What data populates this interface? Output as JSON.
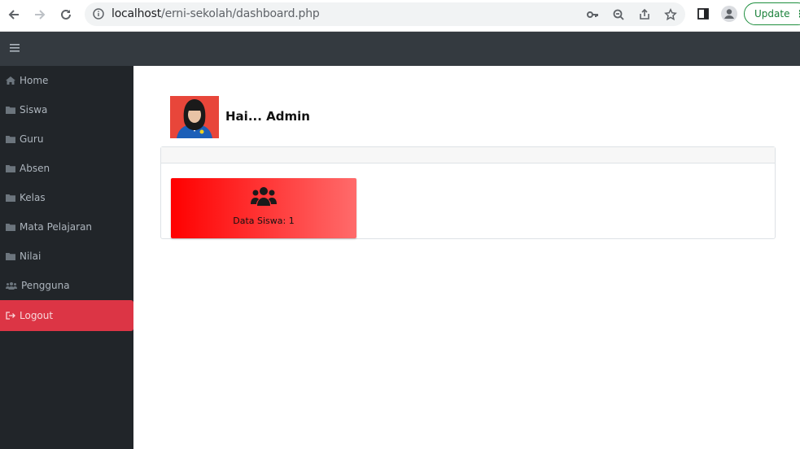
{
  "browser": {
    "url_host": "localhost",
    "url_path": "/erni-sekolah/dashboard.php",
    "update_label": "Update"
  },
  "sidebar": {
    "items": [
      {
        "label": "Home",
        "icon": "home-icon"
      },
      {
        "label": "Siswa",
        "icon": "folder-icon"
      },
      {
        "label": "Guru",
        "icon": "folder-icon"
      },
      {
        "label": "Absen",
        "icon": "folder-icon"
      },
      {
        "label": "Kelas",
        "icon": "folder-icon"
      },
      {
        "label": "Mata Pelajaran",
        "icon": "folder-icon"
      },
      {
        "label": "Nilai",
        "icon": "folder-icon"
      },
      {
        "label": "Pengguna",
        "icon": "users-icon"
      },
      {
        "label": "Logout",
        "icon": "sign-out-icon"
      }
    ]
  },
  "main": {
    "greeting": "Hai... Admin",
    "stat": {
      "label": "Data Siswa: 1",
      "icon": "users-icon"
    }
  },
  "colors": {
    "topnav": "#343a40",
    "sidebar": "#212529",
    "logout": "#dc3545",
    "stat_gradient_start": "#ff0000",
    "stat_gradient_end": "#ff6b6b"
  }
}
